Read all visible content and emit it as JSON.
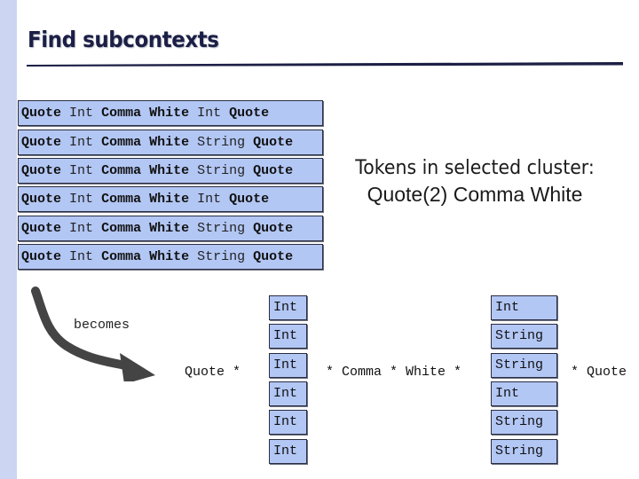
{
  "title": "Find subcontexts",
  "sequences": [
    [
      {
        "t": "Quote",
        "b": true
      },
      {
        "t": "Int",
        "b": false
      },
      {
        "t": "Comma",
        "b": true
      },
      {
        "t": "White",
        "b": true
      },
      {
        "t": "Int",
        "b": false
      },
      {
        "t": "Quote",
        "b": true
      }
    ],
    [
      {
        "t": "Quote",
        "b": true
      },
      {
        "t": "Int",
        "b": false
      },
      {
        "t": "Comma",
        "b": true
      },
      {
        "t": "White",
        "b": true
      },
      {
        "t": "String",
        "b": false
      },
      {
        "t": "Quote",
        "b": true
      }
    ],
    [
      {
        "t": "Quote",
        "b": true
      },
      {
        "t": "Int",
        "b": false
      },
      {
        "t": "Comma",
        "b": true
      },
      {
        "t": "White",
        "b": true
      },
      {
        "t": "String",
        "b": false
      },
      {
        "t": "Quote",
        "b": true
      }
    ],
    [
      {
        "t": "Quote",
        "b": true
      },
      {
        "t": "Int",
        "b": false
      },
      {
        "t": "Comma",
        "b": true
      },
      {
        "t": "White",
        "b": true
      },
      {
        "t": "Int",
        "b": false
      },
      {
        "t": "Quote",
        "b": true
      }
    ],
    [
      {
        "t": "Quote",
        "b": true
      },
      {
        "t": "Int",
        "b": false
      },
      {
        "t": "Comma",
        "b": true
      },
      {
        "t": "White",
        "b": true
      },
      {
        "t": "String",
        "b": false
      },
      {
        "t": "Quote",
        "b": true
      }
    ],
    [
      {
        "t": "Quote",
        "b": true
      },
      {
        "t": "Int",
        "b": false
      },
      {
        "t": "Comma",
        "b": true
      },
      {
        "t": "White",
        "b": true
      },
      {
        "t": "String",
        "b": false
      },
      {
        "t": "Quote",
        "b": true
      }
    ]
  ],
  "cluster": {
    "title": "Tokens in selected cluster:",
    "tokens": "Quote(2) Comma White"
  },
  "becomes_label": "becomes",
  "pattern": {
    "prefix": "Quote *",
    "middle": "* Comma * White *",
    "suffix": "* Quote",
    "column1": [
      "Int",
      "Int",
      "Int",
      "Int",
      "Int",
      "Int"
    ],
    "column2": [
      "Int",
      "String",
      "String",
      "Int",
      "String",
      "String"
    ]
  },
  "colors": {
    "sidebar": "#ccd5f2",
    "box_fill": "#b3c7f5",
    "title": "#1c1f45",
    "arrow": "#444444"
  }
}
